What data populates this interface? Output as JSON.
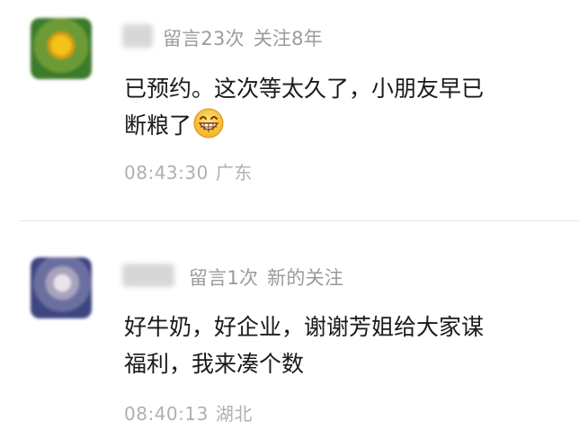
{
  "comments": [
    {
      "meta": {
        "count": "留言23次",
        "follow": "关注8年"
      },
      "content": {
        "line1": "已预约。这次等太久了，小朋友早已",
        "line2": "断粮了"
      },
      "emoji": "grinning-face-icon",
      "time": "08:43:30",
      "location": "广东"
    },
    {
      "meta": {
        "count": "留言1次",
        "follow": "新的关注"
      },
      "content": {
        "line1": "好牛奶，好企业，谢谢芳姐给大家谋",
        "line2": "福利，我来凑个数"
      },
      "time": "08:40:13",
      "location": "湖北"
    }
  ],
  "colors": {
    "meta": "#9b9b9b",
    "text": "#1a1a1a",
    "time": "#b0b0b0",
    "divider": "#e6e6e6"
  }
}
